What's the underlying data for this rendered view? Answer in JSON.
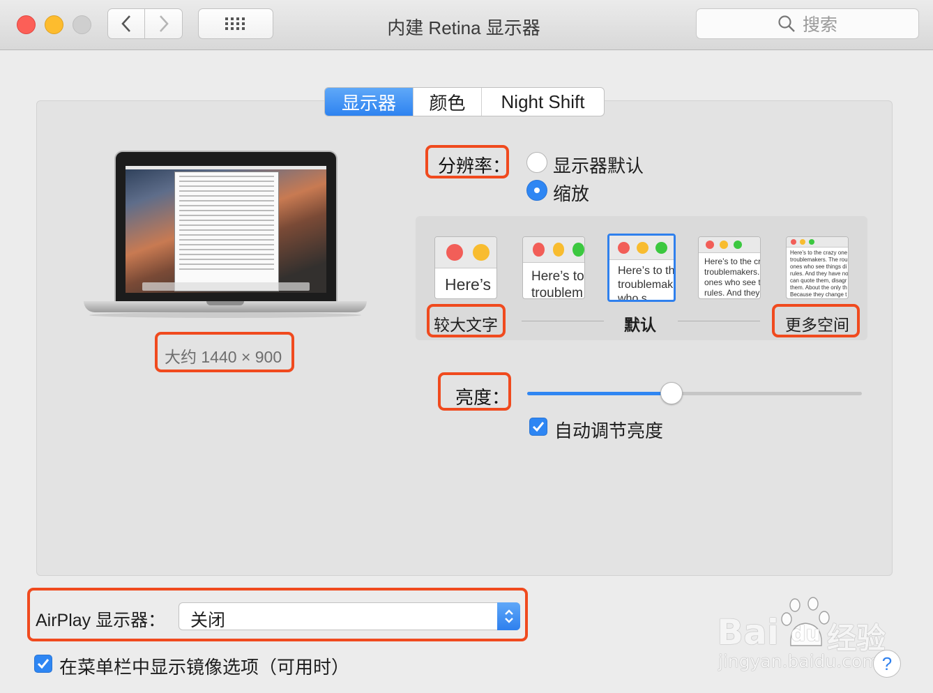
{
  "window": {
    "title": "内建 Retina 显示器",
    "search_placeholder": "搜索"
  },
  "tabs": [
    {
      "label": "显示器",
      "active": true
    },
    {
      "label": "颜色",
      "active": false
    },
    {
      "label": "Night Shift",
      "active": false
    }
  ],
  "display": {
    "resolution_text": "大约 1440 × 900"
  },
  "resolution": {
    "label": "分辨率：",
    "options": [
      {
        "label": "显示器默认",
        "selected": false
      },
      {
        "label": "缩放",
        "selected": true
      }
    ],
    "scale_labels": {
      "larger": "较大文字",
      "default": "默认",
      "more_space": "更多空间"
    },
    "thumbnails": [
      {
        "text": "Here’s",
        "selected": false
      },
      {
        "text": "Here’s to troublem",
        "selected": false
      },
      {
        "text": "Here’s to th troublemak ones who s",
        "selected": true
      },
      {
        "text": "Here’s to the cr troublemakers. ones who see t rules. And they",
        "selected": false
      },
      {
        "text": "Here’s to the crazy one troublemakers. The rou ones who see things di rules. And they have no can quote them, disagr them. About the only th Because they change t",
        "selected": false
      }
    ]
  },
  "brightness": {
    "label": "亮度：",
    "level": 0.43,
    "auto_label": "自动调节亮度",
    "auto_checked": true
  },
  "airplay": {
    "label": "AirPlay 显示器：",
    "value": "关闭"
  },
  "mirror_option": {
    "label": "在菜单栏中显示镜像选项（可用时）",
    "checked": true
  },
  "watermark": {
    "brand": "Bai",
    "brand2": "du",
    "cn": "经验",
    "url": "jingyan.baidu.com"
  },
  "help_label": "?",
  "colors": {
    "accent": "#2e86f3",
    "highlight": "#f04a1e",
    "close": "#fc5f57",
    "minimize": "#fdbc2e"
  }
}
